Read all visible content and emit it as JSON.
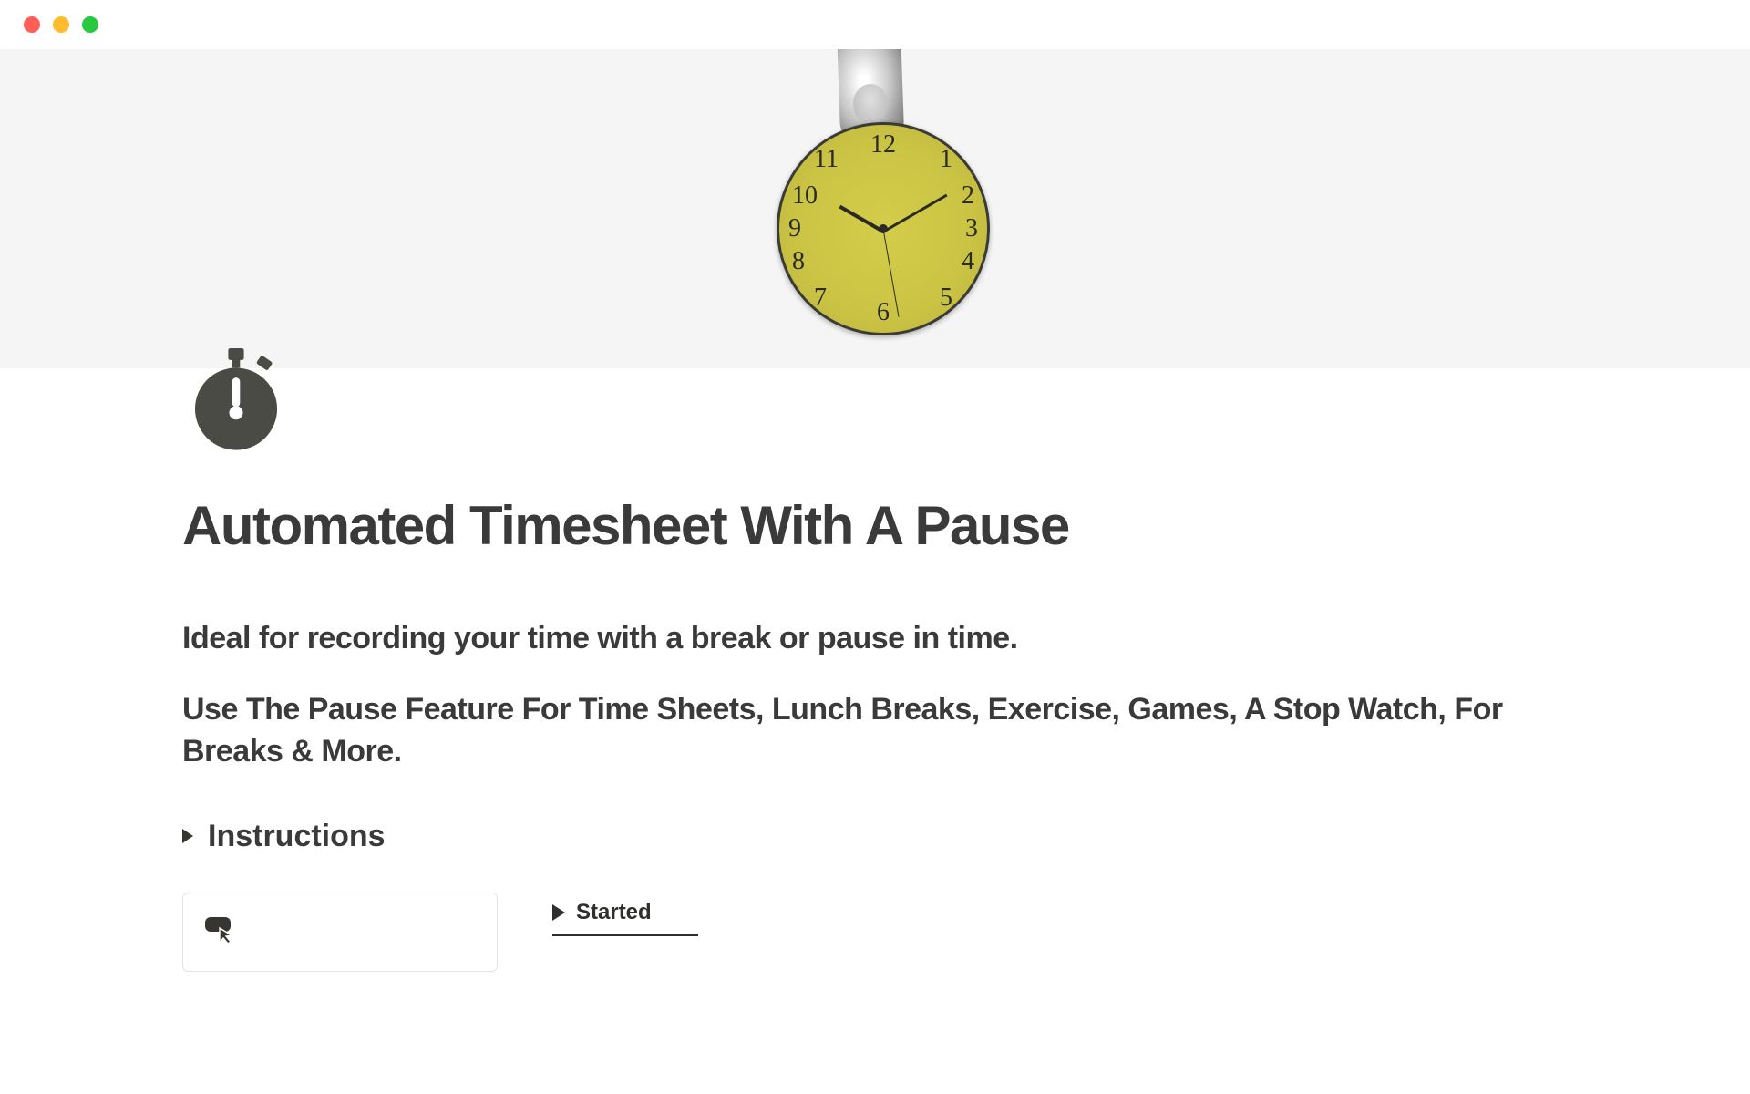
{
  "clock": {
    "numbers": {
      "n1": "1",
      "n2": "2",
      "n3": "3",
      "n4": "4",
      "n5": "5",
      "n6": "6",
      "n7": "7",
      "n8": "8",
      "n9": "9",
      "n10": "10",
      "n11": "11",
      "n12": "12"
    }
  },
  "page": {
    "title": "Automated Timesheet With A Pause",
    "subtitle_1": "Ideal for recording your time with a break or pause in time.",
    "subtitle_2": "Use The Pause Feature For Time Sheets, Lunch Breaks, Exercise, Games, A Stop Watch, For Breaks & More."
  },
  "toggle": {
    "instructions_label": "Instructions"
  },
  "database": {
    "view_label": "Started"
  },
  "colors": {
    "text": "#3a3a3a",
    "clock_face": "#cac344",
    "hero_bg": "#f5f5f5"
  }
}
